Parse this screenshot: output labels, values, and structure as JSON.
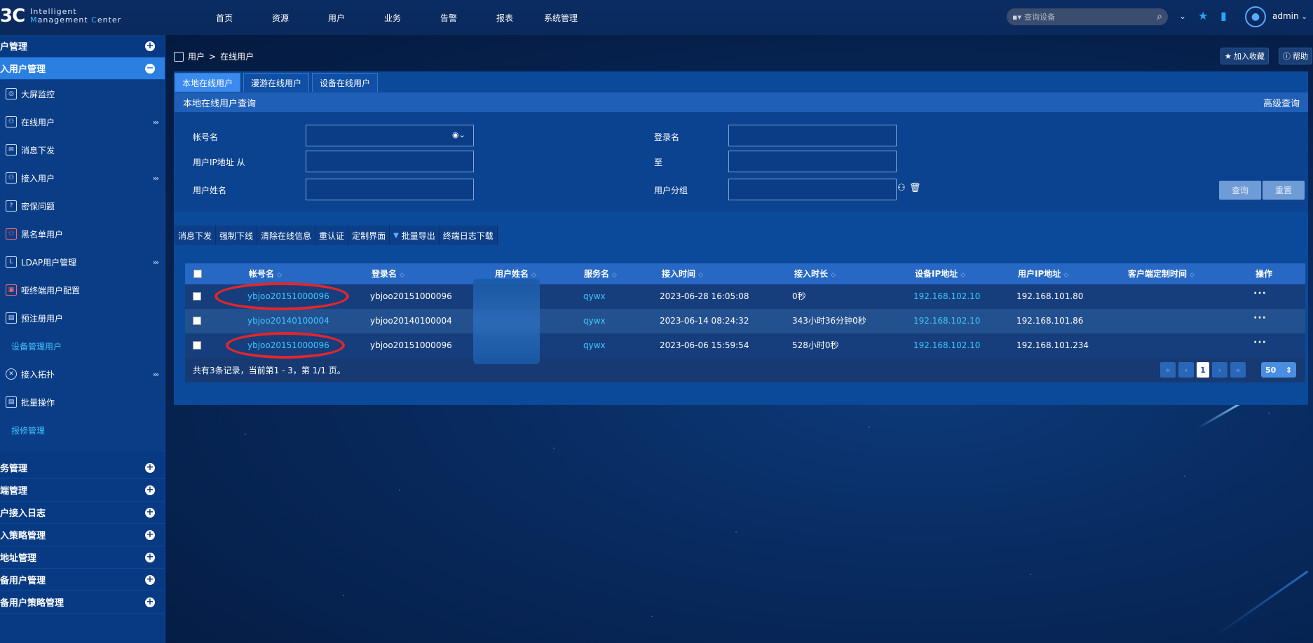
{
  "brand": {
    "mark": "3C",
    "line1": "Intelligent",
    "line2a": "M",
    "line2b": "anagement ",
    "line2c": "C",
    "line2d": "enter"
  },
  "nav": [
    "首页",
    "资源",
    "用户",
    "业务",
    "告警",
    "报表",
    "系统管理"
  ],
  "search": {
    "placeholder": "查询设备"
  },
  "user": {
    "name": "admin"
  },
  "sidebar": {
    "top_sections": [
      {
        "label": "户管理"
      },
      {
        "label": "入用户管理"
      }
    ],
    "items": [
      {
        "label": "大屏监控",
        "icon": "monitor-icon"
      },
      {
        "label": "在线用户",
        "icon": "online-user-icon",
        "arrow": "›››"
      },
      {
        "label": "消息下发",
        "icon": "message-icon"
      },
      {
        "label": "接入用户",
        "icon": "access-user-icon",
        "arrow": "›››"
      },
      {
        "label": "密保问题",
        "icon": "security-question-icon"
      },
      {
        "label": "黑名单用户",
        "icon": "blacklist-icon"
      },
      {
        "label": "LDAP用户管理",
        "icon": "ldap-icon",
        "arrow": "›››"
      },
      {
        "label": "哑终端用户配置",
        "icon": "dumb-terminal-icon"
      },
      {
        "label": "预注册用户",
        "icon": "preregister-icon"
      },
      {
        "label": "设备管理用户"
      },
      {
        "label": "接入拓扑",
        "icon": "topology-icon",
        "arrow": "›››"
      },
      {
        "label": "批量操作",
        "icon": "batch-icon"
      },
      {
        "label": "报修管理"
      }
    ],
    "bottom_sections": [
      {
        "label": "务管理"
      },
      {
        "label": "端管理"
      },
      {
        "label": "户接入日志"
      },
      {
        "label": "入策略管理"
      },
      {
        "label": "地址管理"
      },
      {
        "label": "备用户管理"
      },
      {
        "label": "备用户策略管理"
      }
    ]
  },
  "breadcrumb": {
    "root": "用户",
    "sep": ">",
    "current": "在线用户"
  },
  "actions": {
    "favorite": "加入收藏",
    "help": "帮助"
  },
  "tabs": [
    "本地在线用户",
    "漫游在线用户",
    "设备在线用户"
  ],
  "query": {
    "title": "本地在线用户查询",
    "advanced": "高级查询",
    "account_label": "帐号名",
    "login_label": "登录名",
    "ip_from_label": "用户IP地址 从",
    "ip_to_label": "至",
    "name_label": "用户姓名",
    "group_label": "用户分组",
    "search_btn": "查询",
    "reset_btn": "重置"
  },
  "toolbar": [
    "消息下发",
    "强制下线",
    "清除在线信息",
    "重认证",
    "定制界面",
    "批量导出",
    "终端日志下载"
  ],
  "table": {
    "columns": [
      "帐号名",
      "登录名",
      "用户姓名",
      "服务名",
      "接入时间",
      "接入时长",
      "设备IP地址",
      "用户IP地址",
      "客户端定制时间",
      "操作"
    ],
    "rows": [
      {
        "account": "ybjoo20151000096",
        "login": "ybjoo20151000096",
        "name": "",
        "service": "qywx",
        "time": "2023-06-28 16:05:08",
        "duration": "0秒",
        "device_ip": "192.168.102.10",
        "user_ip": "192.168.101.80",
        "client_time": "",
        "op": "···"
      },
      {
        "account": "ybjoo20140100004",
        "login": "ybjoo20140100004",
        "name": "",
        "service": "qywx",
        "time": "2023-06-14 08:24:32",
        "duration": "343小时36分钟0秒",
        "device_ip": "192.168.102.10",
        "user_ip": "192.168.101.86",
        "client_time": "",
        "op": "···"
      },
      {
        "account": "ybjoo20151000096",
        "login": "ybjoo20151000096",
        "name": "",
        "service": "qywx",
        "time": "2023-06-06 15:59:54",
        "duration": "528小时0秒",
        "device_ip": "192.168.102.10",
        "user_ip": "192.168.101.234",
        "client_time": "",
        "op": "···"
      }
    ],
    "summary": "共有3条记录，当前第1 - 3，第 1/1 页。"
  },
  "pager": {
    "first": "«",
    "prev": "‹",
    "current": "1",
    "next": "›",
    "last": "»",
    "page_size": "50"
  },
  "colors": {
    "accent": "#2a7fe0",
    "link": "#3fc8ff",
    "highlight_ring": "#e3262b"
  }
}
